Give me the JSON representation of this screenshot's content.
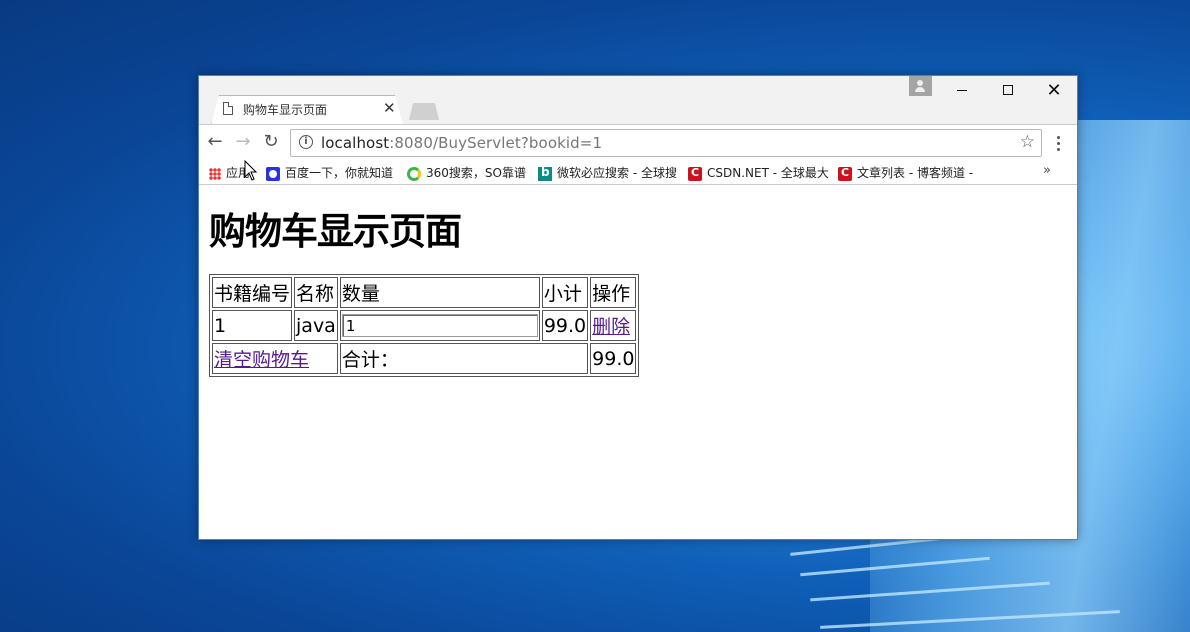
{
  "browser": {
    "tab_title": "购物车显示页面",
    "tab_close": "✕",
    "url_host": "localhost",
    "url_rest": ":8080/BuyServlet?bookid=1",
    "info_symbol": "i",
    "star": "☆",
    "back": "←",
    "forward": "→",
    "reload": "↻",
    "min": "",
    "close": "✕"
  },
  "bookmarks": {
    "items": [
      {
        "label": "应用",
        "icon": "apps-icon"
      },
      {
        "label": "百度一下，你就知道",
        "icon": "baidu-icon"
      },
      {
        "label": "360搜索，SO靠谱",
        "icon": "360-icon"
      },
      {
        "label": "微软必应搜索 - 全球搜",
        "icon": "bing-icon"
      },
      {
        "label": "CSDN.NET - 全球最大",
        "icon": "csdn-icon"
      },
      {
        "label": "文章列表 - 博客频道 -",
        "icon": "csdn-icon"
      }
    ],
    "more": "»"
  },
  "page": {
    "heading": "购物车显示页面",
    "table": {
      "headers": [
        "书籍编号",
        "名称",
        "数量",
        "小计",
        "操作"
      ],
      "rows": [
        {
          "id": "1",
          "name": "java",
          "quantity": "1",
          "subtotal": "99.0",
          "action": "删除"
        }
      ],
      "clear_link": "清空购物车",
      "total_label": "合计：",
      "total_value": "99.0"
    }
  }
}
